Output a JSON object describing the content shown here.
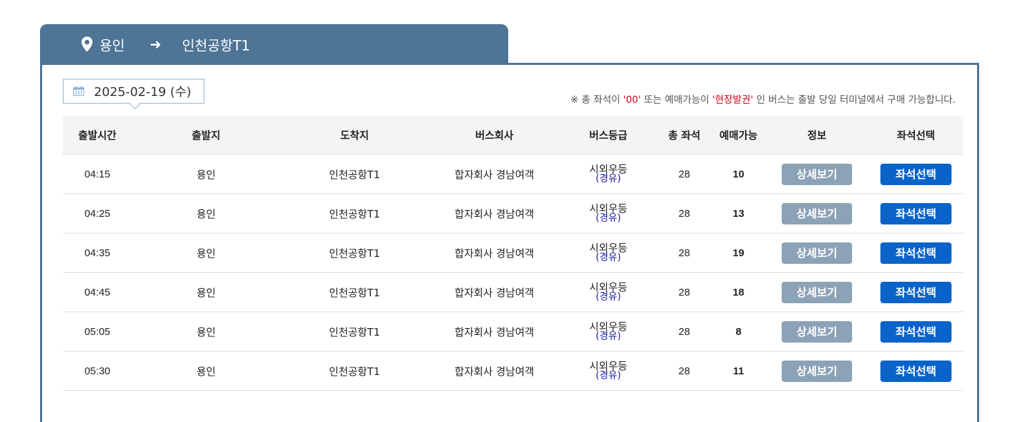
{
  "route": {
    "origin": "용인",
    "arrow": "➜",
    "destination": "인천공항T1"
  },
  "date": {
    "value": "2025-02-19 (수)"
  },
  "notice": {
    "prefix": "※ 총 좌석이 ",
    "zero": "'00'",
    "middle": " 또는 예매가능이 ",
    "onsite": "'현장발권'",
    "suffix": " 인 버스는 출발 당일 터미널에서 구매 가능합니다."
  },
  "table": {
    "headers": [
      "출발시간",
      "출발지",
      "도착지",
      "버스회사",
      "버스등급",
      "총 좌석",
      "예매가능",
      "정보",
      "좌석선택"
    ],
    "rows": [
      {
        "time": "04:15",
        "origin": "용인",
        "dest": "인천공항T1",
        "company": "합자회사 경남여객",
        "grade": "시외우등",
        "via": "(경유)",
        "total": "28",
        "avail": "10",
        "detail": "상세보기",
        "select": "좌석선택"
      },
      {
        "time": "04:25",
        "origin": "용인",
        "dest": "인천공항T1",
        "company": "합자회사 경남여객",
        "grade": "시외우등",
        "via": "(경유)",
        "total": "28",
        "avail": "13",
        "detail": "상세보기",
        "select": "좌석선택"
      },
      {
        "time": "04:35",
        "origin": "용인",
        "dest": "인천공항T1",
        "company": "합자회사 경남여객",
        "grade": "시외우등",
        "via": "(경유)",
        "total": "28",
        "avail": "19",
        "detail": "상세보기",
        "select": "좌석선택"
      },
      {
        "time": "04:45",
        "origin": "용인",
        "dest": "인천공항T1",
        "company": "합자회사 경남여객",
        "grade": "시외우등",
        "via": "(경유)",
        "total": "28",
        "avail": "18",
        "detail": "상세보기",
        "select": "좌석선택"
      },
      {
        "time": "05:05",
        "origin": "용인",
        "dest": "인천공항T1",
        "company": "합자회사 경남여객",
        "grade": "시외우등",
        "via": "(경유)",
        "total": "28",
        "avail": "8",
        "detail": "상세보기",
        "select": "좌석선택"
      },
      {
        "time": "05:30",
        "origin": "용인",
        "dest": "인천공항T1",
        "company": "합자회사 경남여객",
        "grade": "시외우등",
        "via": "(경유)",
        "total": "28",
        "avail": "11",
        "detail": "상세보기",
        "select": "좌석선택"
      }
    ]
  },
  "icons": {
    "route_origin": "location-pin-icon",
    "date": "calendar-icon"
  },
  "colors": {
    "header_bar": "#4e7496",
    "seat_button": "#0a63c9",
    "detail_button": "#8ca2b7",
    "notice_highlight": "#d0021b"
  }
}
